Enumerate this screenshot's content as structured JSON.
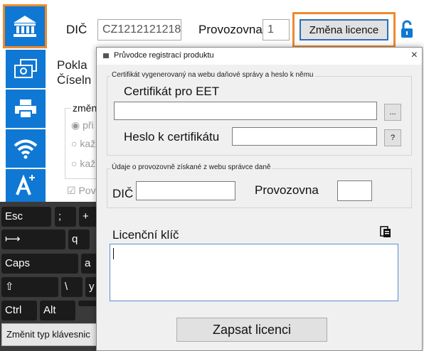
{
  "topbar": {
    "dic_label": "DIČ",
    "dic_value": "CZ1212121218",
    "provozovna_label": "Provozovna",
    "provozovna_value": "1",
    "change_license_label": "Změna licence"
  },
  "background": {
    "line1": "Pokla",
    "line2": "Číseln",
    "group_label": "změn",
    "radio1": "při",
    "radio2": "kaž",
    "radio3": "kaž",
    "checkbox": "Pov"
  },
  "keyboard": {
    "esc": "Esc",
    "semicolon": ";",
    "plus": "+",
    "q": "q",
    "caps": "Caps",
    "a": "a",
    "backslash": "\\",
    "y": "y",
    "ctrl": "Ctrl",
    "alt": "Alt",
    "change_type": "Změnit typ klávesnic"
  },
  "dialog": {
    "title": "Průvodce registrací produktu",
    "close": "×",
    "cert_group_legend": "Certifikát vygenerovaný na webu daňové správy a heslo k němu",
    "cert_label": "Certifikát pro EET",
    "browse_button": "...",
    "password_label": "Heslo k certifikátu",
    "help_button": "?",
    "prov_group_legend": "Údaje o provozovně získané z webu správce daně",
    "dic_label": "DIČ",
    "provozovna_label": "Provozovna",
    "license_key_label": "Licenční klíč",
    "submit_label": "Zapsat licenci"
  },
  "colors": {
    "accent_blue": "#0f78d4",
    "highlight_orange": "#ed8b2c"
  },
  "icons": [
    "bank-icon",
    "cash-register-icon",
    "printer-icon",
    "wifi-icon",
    "font-size-icon",
    "unlock-icon",
    "paste-icon"
  ]
}
